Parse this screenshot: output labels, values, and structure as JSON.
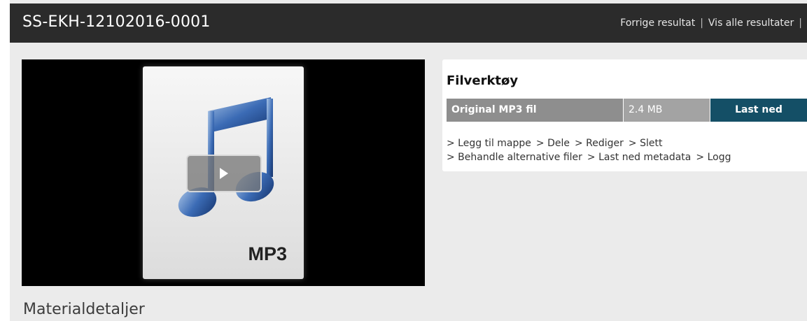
{
  "header": {
    "title": "SS-EKH-12102016-0001",
    "nav": {
      "previous": "Forrige resultat",
      "view_all": "Vis alle resultater",
      "separator": "|"
    }
  },
  "player": {
    "thumbnail_label": "MP3",
    "play_icon": "play-icon",
    "note_icon": "music-note-icon"
  },
  "filetools": {
    "title": "Filverktøy",
    "file": {
      "name": "Original MP3 fil",
      "size": "2.4 MB",
      "download_label": "Last ned"
    },
    "links_row1": [
      "> Legg til mappe",
      "> Dele",
      "> Rediger",
      "> Slett"
    ],
    "links_row2": [
      "> Behandle alternative filer",
      "> Last ned metadata",
      "> Logg"
    ]
  },
  "details": {
    "title": "Materialdetaljer"
  },
  "colors": {
    "header_bg": "#2b2b2b",
    "page_bg": "#ebebeb",
    "download_bg": "#144f66",
    "file_name_bg": "#8e8e8e",
    "file_size_bg": "#a3a3a3"
  }
}
